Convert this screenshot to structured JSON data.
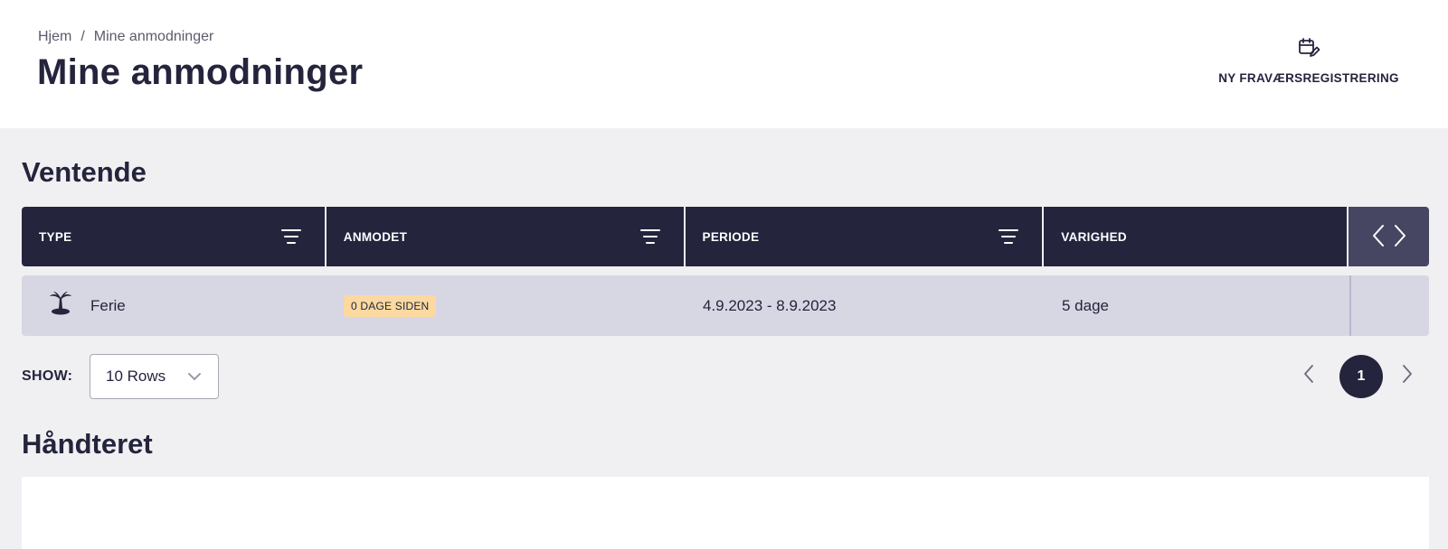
{
  "breadcrumb": {
    "home": "Hjem",
    "separator": "/",
    "current": "Mine anmodninger"
  },
  "page_title": "Mine anmodninger",
  "actions": {
    "new_absence_label": "NY FRAVÆRSREGISTRERING",
    "new_absence_icon": "calendar-edit-icon"
  },
  "pending": {
    "title": "Ventende",
    "columns": [
      "TYPE",
      "ANMODET",
      "PERIODE",
      "VARIGHED"
    ],
    "rows": [
      {
        "icon": "palm-tree-icon",
        "type": "Ferie",
        "requested": "0 DAGE SIDEN",
        "period": "4.9.2023 - 8.9.2023",
        "duration": "5 dage"
      }
    ]
  },
  "pagination": {
    "show_label": "SHOW:",
    "rows_value": "10 Rows",
    "current_page": "1"
  },
  "handled": {
    "title": "Håndteret"
  },
  "colors": {
    "header_dark": "#24243d",
    "nav_cell": "#464663",
    "row_bg": "#d7d6e3",
    "badge_bg": "#fcd9a0",
    "page_bg": "#f0f0f3"
  }
}
